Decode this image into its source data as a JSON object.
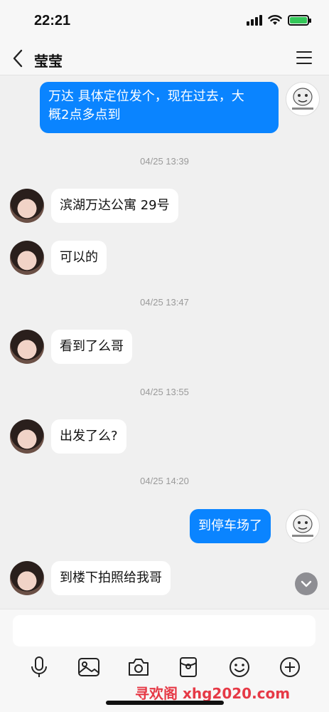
{
  "status_bar": {
    "time": "22:21"
  },
  "header": {
    "title": "莹莹"
  },
  "messages": [
    {
      "text": "万达 具体定位发个，现在过去，大\n概2点多点到"
    },
    {
      "timestamp": "04/25 13:39"
    },
    {
      "text": "滨湖万达公寓 29号"
    },
    {
      "text": "可以的"
    },
    {
      "timestamp": "04/25 13:47"
    },
    {
      "text": "看到了么哥"
    },
    {
      "timestamp": "04/25 13:55"
    },
    {
      "text": "出发了么?"
    },
    {
      "timestamp": "04/25 14:20"
    },
    {
      "text": "到停车场了"
    },
    {
      "text": "到楼下拍照给我哥"
    }
  ],
  "input": {
    "placeholder": ""
  },
  "toolbar": [
    "mic-icon",
    "image-icon",
    "camera-icon",
    "red-packet-icon",
    "emoji-icon",
    "plus-icon"
  ],
  "watermark": "寻欢阁 xhg2020.com",
  "colors": {
    "out_bubble": "#0a84ff",
    "in_bubble": "#ffffff",
    "background": "#f0f0f0"
  }
}
